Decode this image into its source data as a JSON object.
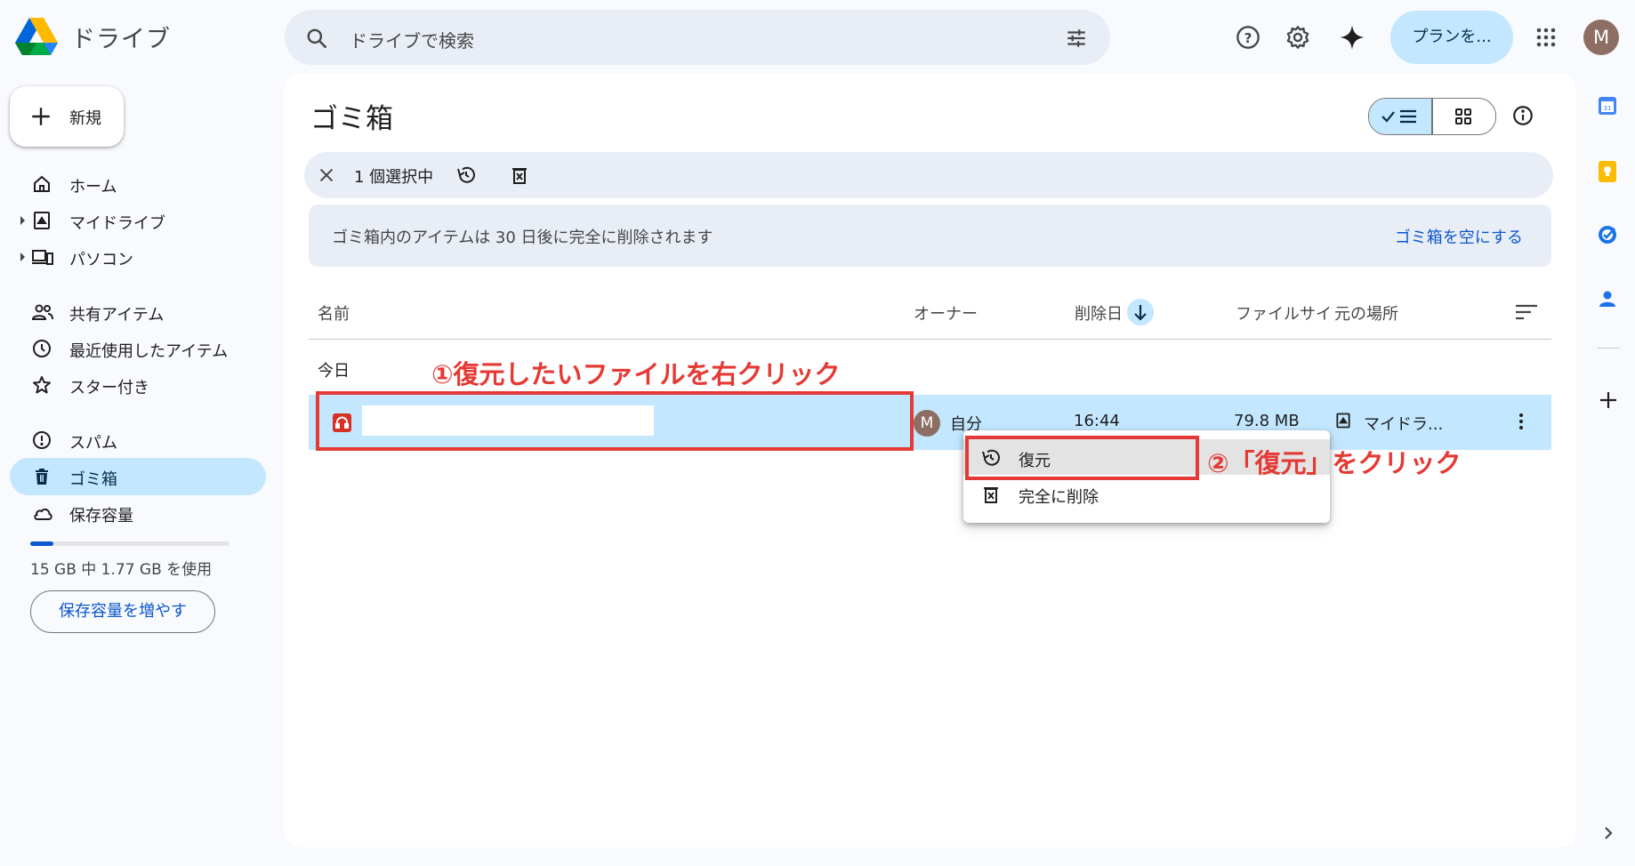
{
  "app": {
    "title": "ドライブ"
  },
  "search": {
    "placeholder": "ドライブで検索"
  },
  "header": {
    "plan_label": "プランを...",
    "avatar_initial": "M"
  },
  "sidebar": {
    "new_label": "新規",
    "items": [
      {
        "label": "ホーム"
      },
      {
        "label": "マイドライブ"
      },
      {
        "label": "パソコン"
      },
      {
        "label": "共有アイテム"
      },
      {
        "label": "最近使用したアイテム"
      },
      {
        "label": "スター付き"
      },
      {
        "label": "スパム"
      },
      {
        "label": "ゴミ箱"
      },
      {
        "label": "保存容量"
      }
    ],
    "storage_text": "15 GB 中 1.77 GB を使用",
    "storage_used_fraction": 0.118,
    "more_storage_label": "保存容量を増やす"
  },
  "main": {
    "title": "ゴミ箱",
    "selection_count": "1 個選択中",
    "notice": "ゴミ箱内のアイテムは 30 日後に完全に削除されます",
    "empty_trash": "ゴミ箱を空にする",
    "columns": {
      "name": "名前",
      "owner": "オーナー",
      "deleted": "削除日",
      "size": "ファイルサイ",
      "location": "元の場所"
    },
    "group_label": "今日",
    "row": {
      "owner_initial": "M",
      "owner": "自分",
      "deleted": "16:44",
      "size": "79.8 MB",
      "location": "マイドラ..."
    }
  },
  "context_menu": {
    "restore": "復元",
    "delete_forever": "完全に削除"
  },
  "annotations": {
    "step1": "①復元したいファイルを右クリック",
    "step2": "②「復元」をクリック"
  },
  "colors": {
    "accent": "#0b57d0",
    "selection": "#c2e7ff",
    "annotation": "#e53935"
  }
}
